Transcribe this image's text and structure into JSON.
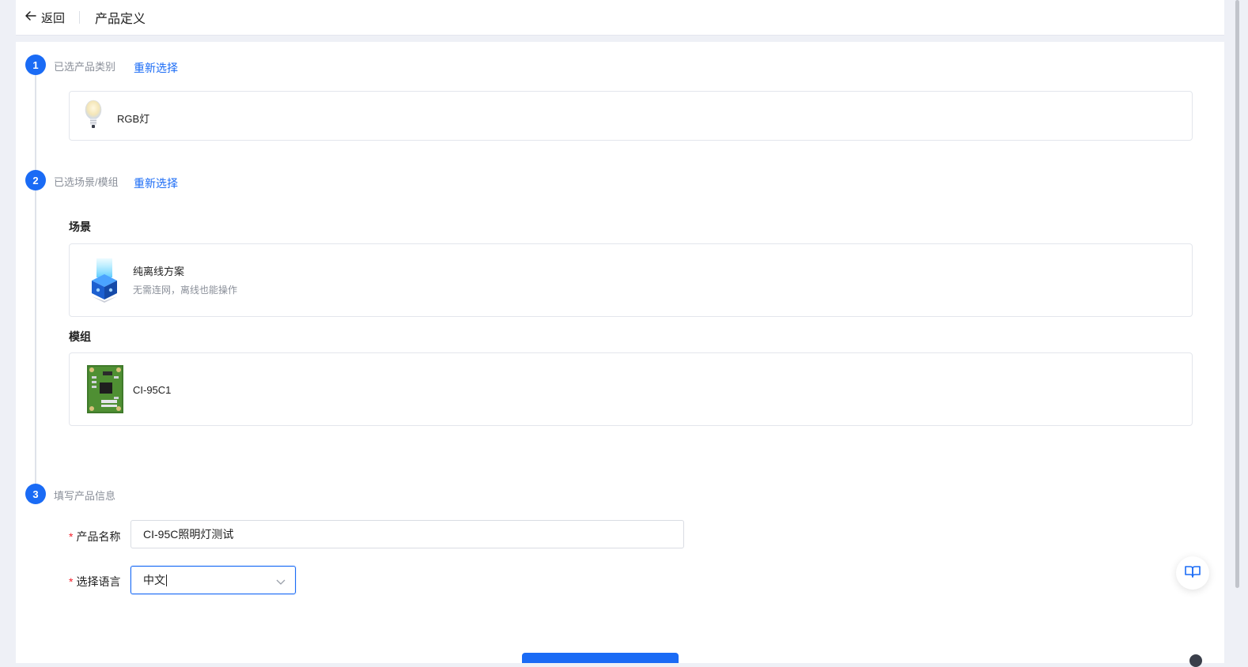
{
  "header": {
    "back_label": "返回",
    "title": "产品定义"
  },
  "steps": [
    {
      "number": "1",
      "label": "已选产品类别",
      "reselect": "重新选择"
    },
    {
      "number": "2",
      "label": "已选场景/模组",
      "reselect": "重新选择"
    },
    {
      "number": "3",
      "label": "填写产品信息"
    }
  ],
  "category": {
    "name": "RGB灯",
    "icon": "light-bulb-icon"
  },
  "scene": {
    "heading": "场景",
    "title": "纯离线方案",
    "description": "无需连网，离线也能操作",
    "icon": "offline-cube-icon"
  },
  "module": {
    "heading": "模组",
    "name": "CI-95C1",
    "icon": "pcb-module-icon"
  },
  "form": {
    "product_name": {
      "label": "产品名称",
      "value": "CI-95C照明灯测试"
    },
    "language": {
      "label": "选择语言",
      "value": "中文"
    }
  },
  "colors": {
    "accent": "#1a6bf5",
    "required": "#f5222d"
  }
}
